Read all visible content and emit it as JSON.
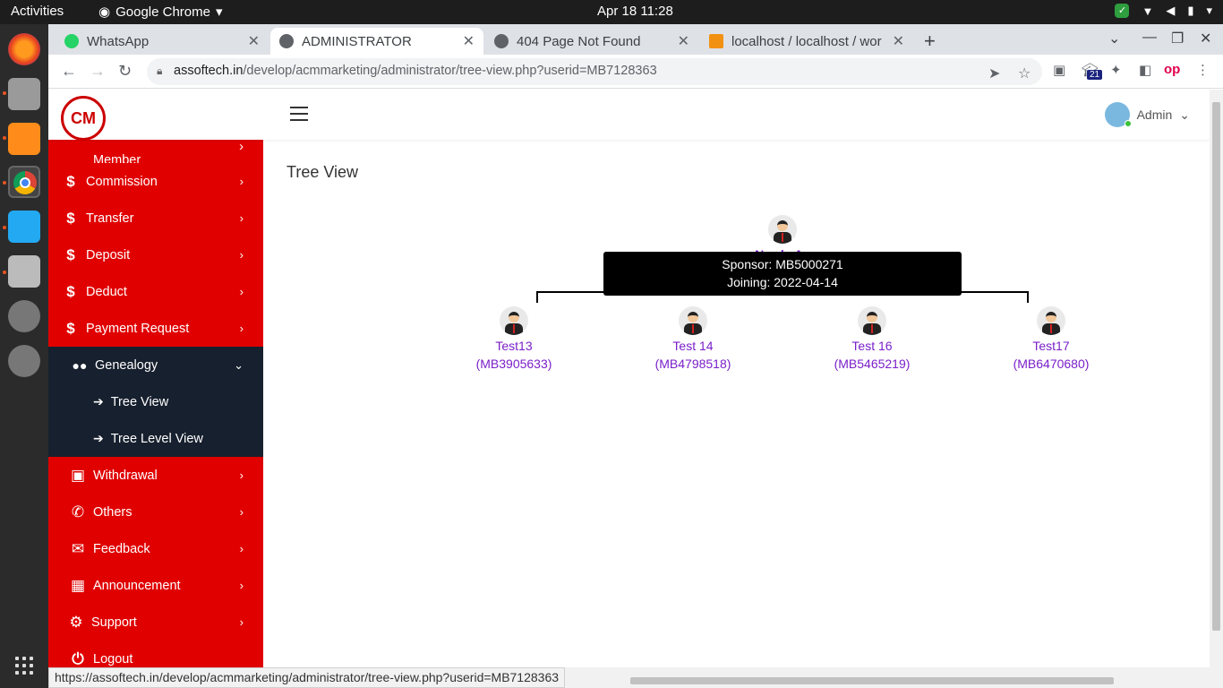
{
  "system": {
    "activities": "Activities",
    "app_name": "Google Chrome",
    "clock": "Apr 18  11:28"
  },
  "tabs": [
    {
      "title": "WhatsApp",
      "favicon_color": "#25d366"
    },
    {
      "title": "ADMINISTRATOR",
      "favicon_color": "#5f6368"
    },
    {
      "title": "404 Page Not Found",
      "favicon_color": "#5f6368"
    },
    {
      "title": "localhost / localhost / wor",
      "favicon_color": "#f29111"
    }
  ],
  "address_bar": {
    "host": "assoftech.in",
    "path": "/develop/acmmarketing/administrator/tree-view.php?userid=MB7128363"
  },
  "extension_badge": "21",
  "header": {
    "admin_label": "Admin",
    "logo_text": "CM"
  },
  "sidebar": {
    "partial_item": "Member",
    "items_top": [
      {
        "icon": "$",
        "label": "Commission"
      },
      {
        "icon": "$",
        "label": "Transfer"
      },
      {
        "icon": "$",
        "label": "Deposit"
      },
      {
        "icon": "$",
        "label": "Deduct"
      },
      {
        "icon": "$",
        "label": "Payment Request"
      }
    ],
    "genealogy": {
      "label": "Genealogy"
    },
    "sub_items": [
      {
        "label": "Tree View"
      },
      {
        "label": "Tree Level View"
      }
    ],
    "items_bottom": [
      {
        "label": "Withdrawal"
      },
      {
        "label": "Others"
      },
      {
        "label": "Feedback"
      },
      {
        "label": "Announcement"
      },
      {
        "label": "Support"
      },
      {
        "label": "Logout"
      }
    ]
  },
  "main": {
    "title": "Tree View",
    "root_partial": "Newly Ac",
    "tooltip": {
      "sponsor": "Sponsor: MB5000271",
      "joining": "Joining: 2022-04-14"
    },
    "children": [
      {
        "name": "Test13",
        "id": "(MB3905633)"
      },
      {
        "name": "Test 14",
        "id": "(MB4798518)"
      },
      {
        "name": "Test 16",
        "id": "(MB5465219)"
      },
      {
        "name": "Test17",
        "id": "(MB6470680)"
      }
    ]
  },
  "status_url": "https://assoftech.in/develop/acmmarketing/administrator/tree-view.php?userid=MB7128363",
  "colors": {
    "sidebar_red": "#e00000",
    "sidebar_dark": "#17202e",
    "link_purple": "#7a1fc9"
  }
}
